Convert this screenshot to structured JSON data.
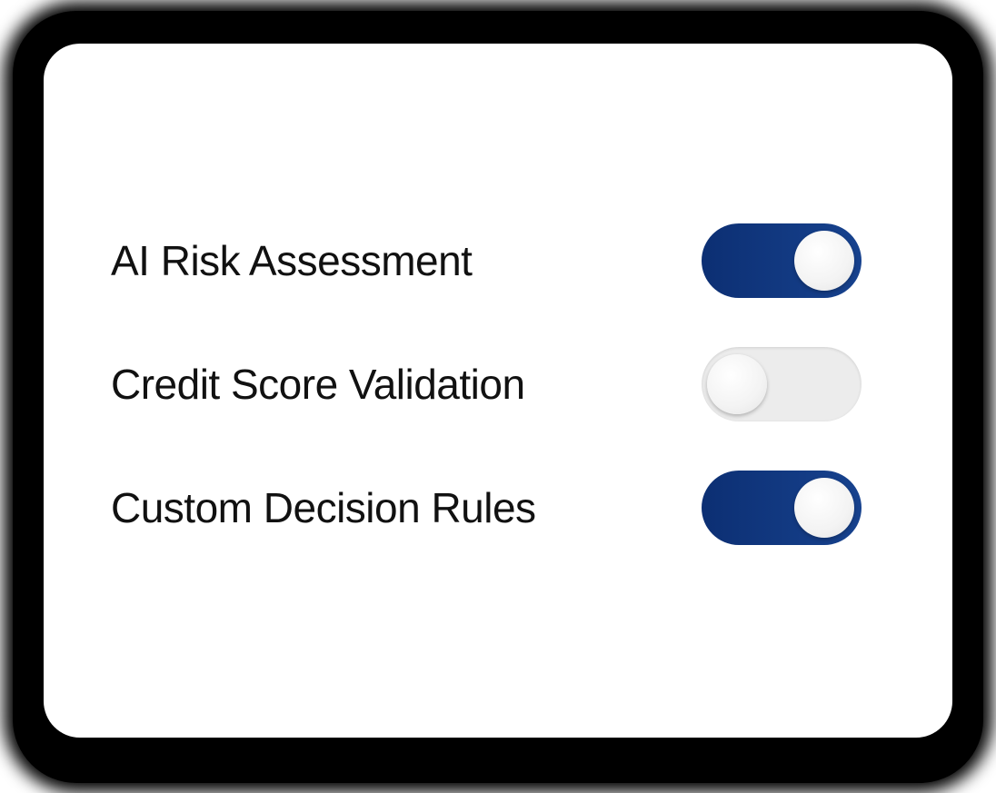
{
  "settings": [
    {
      "label": "AI Risk Assessment",
      "enabled": true
    },
    {
      "label": "Credit Score Validation",
      "enabled": false
    },
    {
      "label": "Custom Decision Rules",
      "enabled": true
    }
  ],
  "colors": {
    "toggle_on": "#0c2f73",
    "toggle_off": "#ececec",
    "knob": "#f3f3f3",
    "label_text": "#111111"
  }
}
